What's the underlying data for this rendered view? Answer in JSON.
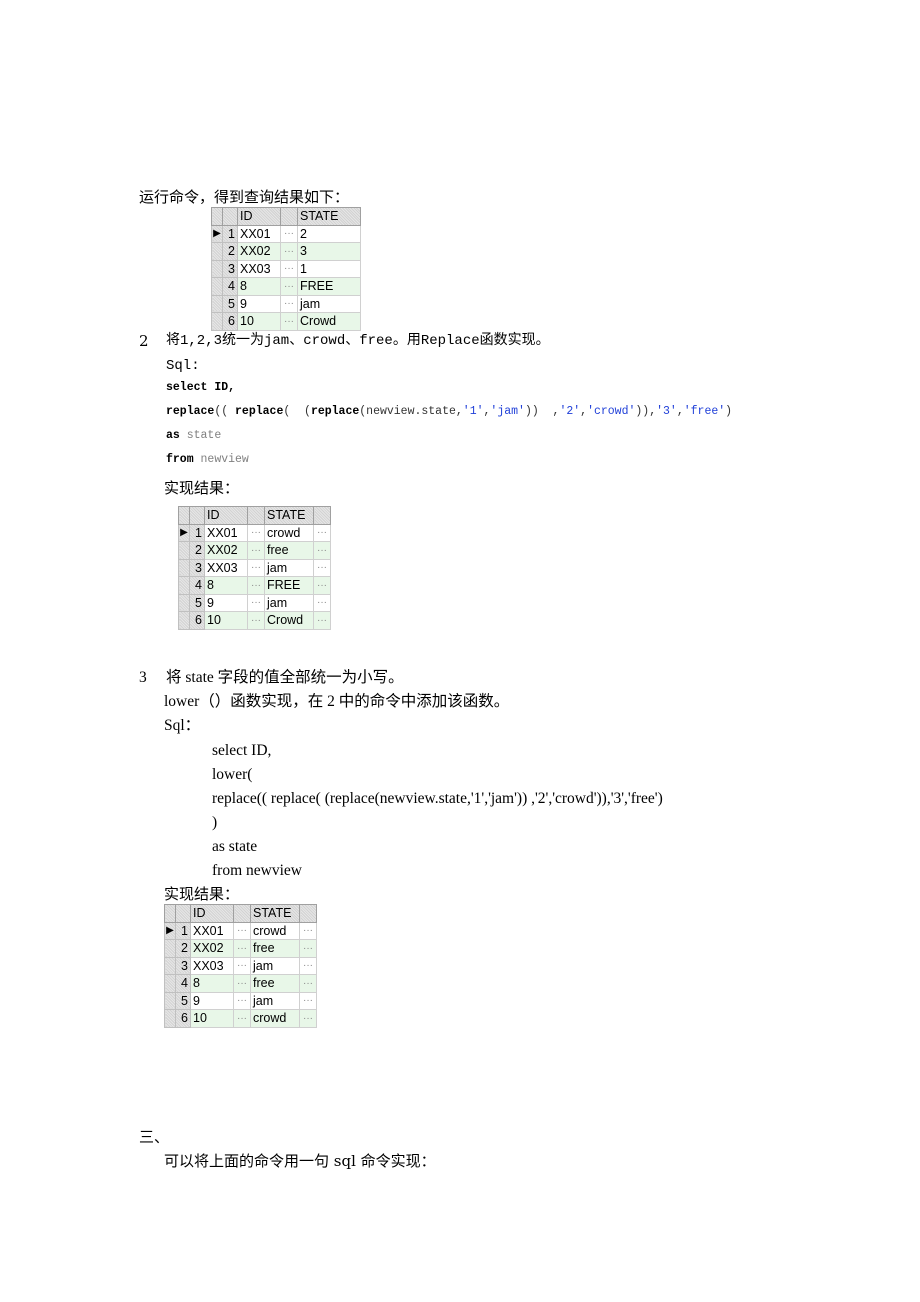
{
  "section1": {
    "intro": "运行命令，得到查询结果如下：",
    "table": {
      "columns": [
        "ID",
        "STATE"
      ],
      "rows": [
        {
          "num": "1",
          "id": "XX01",
          "state": "2",
          "current": true
        },
        {
          "num": "2",
          "id": "XX02",
          "state": "3"
        },
        {
          "num": "3",
          "id": "XX03",
          "state": "1"
        },
        {
          "num": "4",
          "id": "8",
          "state": "FREE"
        },
        {
          "num": "5",
          "id": "9",
          "state": "jam"
        },
        {
          "num": "6",
          "id": "10",
          "state": "Crowd"
        }
      ]
    }
  },
  "section2": {
    "number": "2",
    "heading": "将1,2,3统一为jam、crowd、free。用Replace函数实现。",
    "sql_label": "Sql:",
    "code": {
      "line1_kw": "select",
      "line1_rest": " ID,",
      "line2_parts": [
        {
          "t": "kw",
          "v": "replace"
        },
        {
          "t": "plain",
          "v": "(( "
        },
        {
          "t": "kw",
          "v": "replace"
        },
        {
          "t": "plain",
          "v": "(  ("
        },
        {
          "t": "kw",
          "v": "replace"
        },
        {
          "t": "plain",
          "v": "(newview.state,"
        },
        {
          "t": "str",
          "v": "'1'"
        },
        {
          "t": "plain",
          "v": ","
        },
        {
          "t": "str",
          "v": "'jam'"
        },
        {
          "t": "plain",
          "v": "))  ,"
        },
        {
          "t": "str",
          "v": "'2'"
        },
        {
          "t": "plain",
          "v": ","
        },
        {
          "t": "str",
          "v": "'crowd'"
        },
        {
          "t": "plain",
          "v": ")),"
        },
        {
          "t": "str",
          "v": "'3'"
        },
        {
          "t": "plain",
          "v": ","
        },
        {
          "t": "str",
          "v": "'free'"
        },
        {
          "t": "plain",
          "v": ")"
        }
      ],
      "line3_kw": "as",
      "line3_rest": " state",
      "line4_kw": "from",
      "line4_rest": " newview"
    },
    "result_label": "实现结果：",
    "table": {
      "columns": [
        "ID",
        "STATE"
      ],
      "rows": [
        {
          "num": "1",
          "id": "XX01",
          "state": "crowd",
          "current": true
        },
        {
          "num": "2",
          "id": "XX02",
          "state": "free"
        },
        {
          "num": "3",
          "id": "XX03",
          "state": "jam"
        },
        {
          "num": "4",
          "id": "8",
          "state": "FREE"
        },
        {
          "num": "5",
          "id": "9",
          "state": "jam"
        },
        {
          "num": "6",
          "id": "10",
          "state": "Crowd"
        }
      ]
    }
  },
  "section3": {
    "number": "3",
    "heading": "将 state 字段的值全部统一为小写。",
    "line2": "lower（）函数实现，在 2 中的命令中添加该函数。",
    "sql_label": "Sql：",
    "code_lines": [
      "select ID,",
      "lower(",
      "replace(( replace( (replace(newview.state,'1','jam')) ,'2','crowd')),'3','free')",
      ")",
      "as state",
      "from newview"
    ],
    "result_label": "实现结果：",
    "table": {
      "columns": [
        "ID",
        "STATE"
      ],
      "rows": [
        {
          "num": "1",
          "id": "XX01",
          "state": "crowd",
          "current": true
        },
        {
          "num": "2",
          "id": "XX02",
          "state": "free"
        },
        {
          "num": "3",
          "id": "XX03",
          "state": "jam"
        },
        {
          "num": "4",
          "id": "8",
          "state": "free"
        },
        {
          "num": "5",
          "id": "9",
          "state": "jam"
        },
        {
          "num": "6",
          "id": "10",
          "state": "crowd"
        }
      ]
    }
  },
  "section4": {
    "heading": "三、",
    "text": "可以将上面的命令用一句 sql 命令实现："
  },
  "icons": {
    "row_pointer": "▶",
    "ellipsis": "···"
  }
}
